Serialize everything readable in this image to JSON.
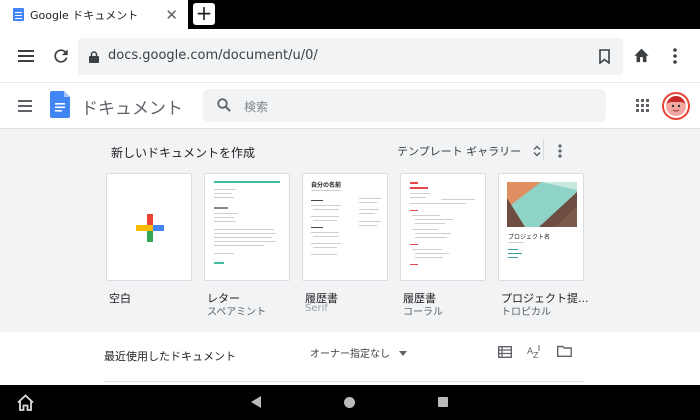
{
  "browser": {
    "tab_title": "Google ドキュメント",
    "url": "docs.google.com/document/u/0/"
  },
  "docs": {
    "app_title": "ドキュメント",
    "search_placeholder": "検索"
  },
  "templates": {
    "heading": "新しいドキュメントを作成",
    "gallery_label": "テンプレート ギャラリー",
    "items": [
      {
        "name": "空白",
        "sub": ""
      },
      {
        "name": "レター",
        "sub": "スペアミント"
      },
      {
        "name": "履歴書",
        "sub": "Serif"
      },
      {
        "name": "履歴書",
        "sub": "コーラル"
      },
      {
        "name": "プロジェクト提...",
        "sub": "トロピカル"
      }
    ],
    "thumb_texts": {
      "serif_title": "自分の名前",
      "project_title": "プロジェクト名"
    }
  },
  "recent": {
    "heading": "最近使用したドキュメント",
    "owner_filter": "オーナー指定なし"
  },
  "colors": {
    "docs_blue": "#4285f4",
    "spearmint": "#3dbfa0",
    "coral": "#e54848",
    "tropical_teal": "#8fd3c7"
  }
}
